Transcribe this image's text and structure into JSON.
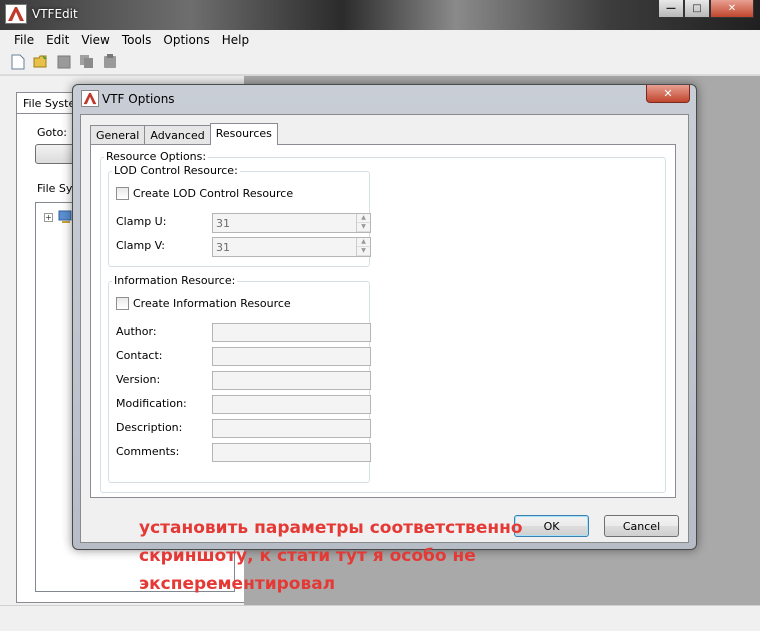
{
  "app": {
    "title": "VTFEdit",
    "menu": [
      "File",
      "Edit",
      "View",
      "Tools",
      "Options",
      "Help"
    ]
  },
  "left_panel": {
    "tab_label": "File Syster",
    "goto_label": "Goto:",
    "fs_label": "File Sys"
  },
  "dialog": {
    "title": "VTF Options",
    "tabs": [
      "General",
      "Advanced",
      "Resources"
    ],
    "active_tab": "Resources",
    "resource_options_label": "Resource Options:",
    "lod": {
      "group_label": "LOD Control Resource:",
      "checkbox_label": "Create LOD Control Resource",
      "checked": false,
      "clamp_u_label": "Clamp U:",
      "clamp_u_value": "31",
      "clamp_v_label": "Clamp V:",
      "clamp_v_value": "31"
    },
    "info": {
      "group_label": "Information Resource:",
      "checkbox_label": "Create Information Resource",
      "checked": false,
      "fields": [
        "Author:",
        "Contact:",
        "Version:",
        "Modification:",
        "Description:",
        "Comments:"
      ]
    },
    "ok_label": "OK",
    "cancel_label": "Cancel"
  },
  "annotation": {
    "line1": "установить параметры соответственно",
    "line2": "скриншоту, к стати тут я особо не",
    "line3": "эксперементировал",
    "color": "#e53935"
  }
}
